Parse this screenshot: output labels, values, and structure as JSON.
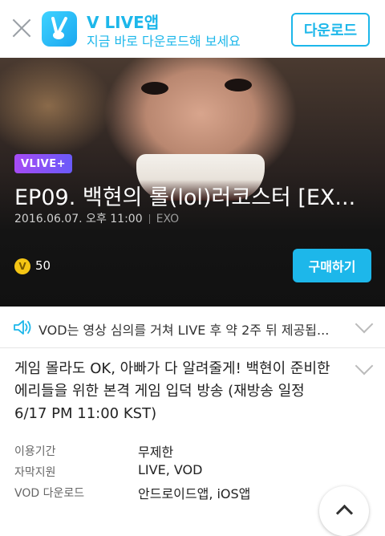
{
  "banner": {
    "app_name": "V LIVE앱",
    "subtitle": "지금 바로 다운로드해 보세요",
    "download_label": "다운로드",
    "accent": "#1db7ea"
  },
  "video": {
    "badge": "VLIVE+",
    "title": "EP09. 백현의 롤(lol)러코스터 [EX...",
    "date": "2016.06.07. 오후 11:00",
    "channel": "EXO",
    "coin_price": "50",
    "coin_symbol": "V",
    "buy_label": "구매하기"
  },
  "notice": {
    "text": "VOD는 영상 심의를 거쳐 LIVE 후 약 2주 뒤 제공됩..."
  },
  "description": "게임 몰라도 OK, 아빠가 다 알려줄게! 백현이 준비한 에리들을 위한 본격 게임 입덕 방송 (재방송 일정 6/17 PM 11:00 KST)",
  "info": [
    {
      "label": "이용기간",
      "value": "무제한"
    },
    {
      "label": "자막지원",
      "value": "LIVE, VOD"
    },
    {
      "label": "VOD 다운로드",
      "value": "안드로이드앱, iOS앱"
    }
  ]
}
